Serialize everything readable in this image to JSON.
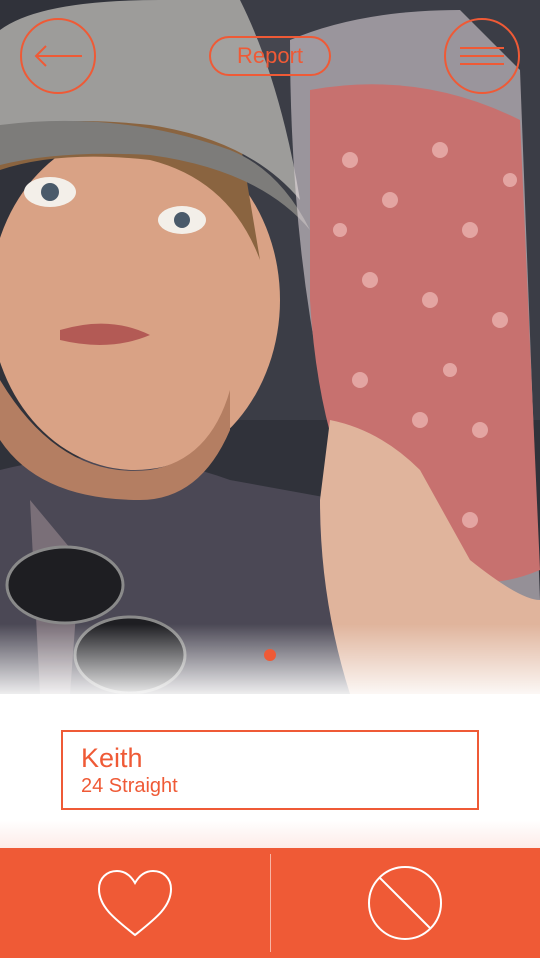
{
  "header": {
    "back_icon": "arrow-left-icon",
    "report_label": "Report",
    "menu_icon": "menu-icon"
  },
  "photo": {
    "icon": "profile-photo",
    "page_indicator": {
      "current": 1,
      "total": 1
    }
  },
  "profile": {
    "name": "Keith",
    "details": "24 Straight"
  },
  "actions": {
    "like_icon": "heart-icon",
    "pass_icon": "block-icon"
  },
  "colors": {
    "accent": "#ef5a36",
    "background": "#ffffff"
  }
}
